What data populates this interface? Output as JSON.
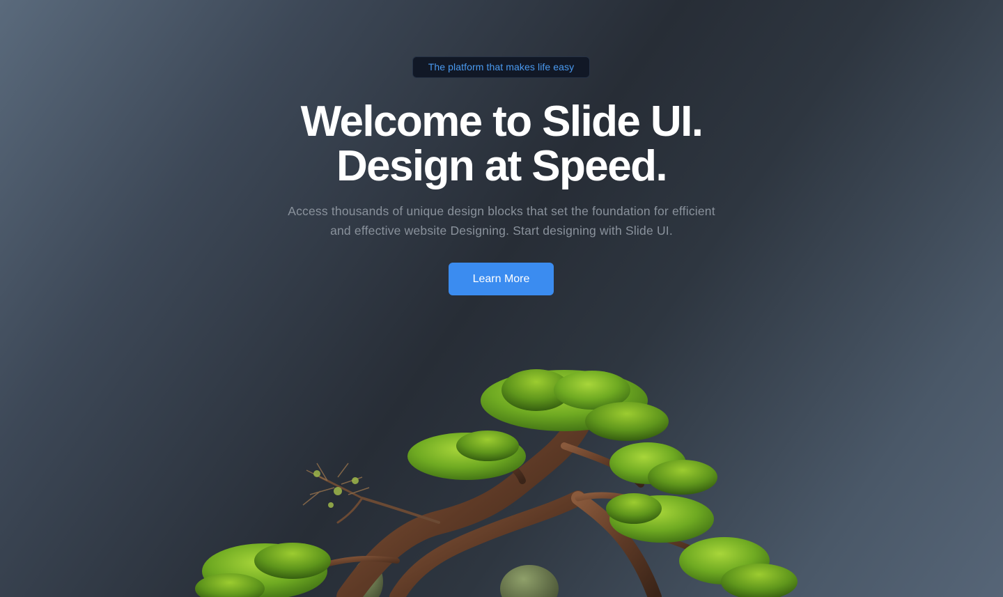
{
  "hero": {
    "badge": "The platform that makes life easy",
    "headline_line1": "Welcome to Slide UI.",
    "headline_line2": "Design at Speed.",
    "subtitle_line1": "Access thousands of unique design blocks that set the foundation for efficient",
    "subtitle_line2": "and effective website Designing. Start designing with Slide UI.",
    "cta_label": "Learn More"
  },
  "colors": {
    "accent": "#3b8cf0",
    "badge_text": "#4a9af0",
    "badge_bg": "#111826",
    "headline": "#ffffff",
    "subtitle": "#8a929c"
  },
  "image": {
    "name": "bonsai-tree-illustration"
  }
}
